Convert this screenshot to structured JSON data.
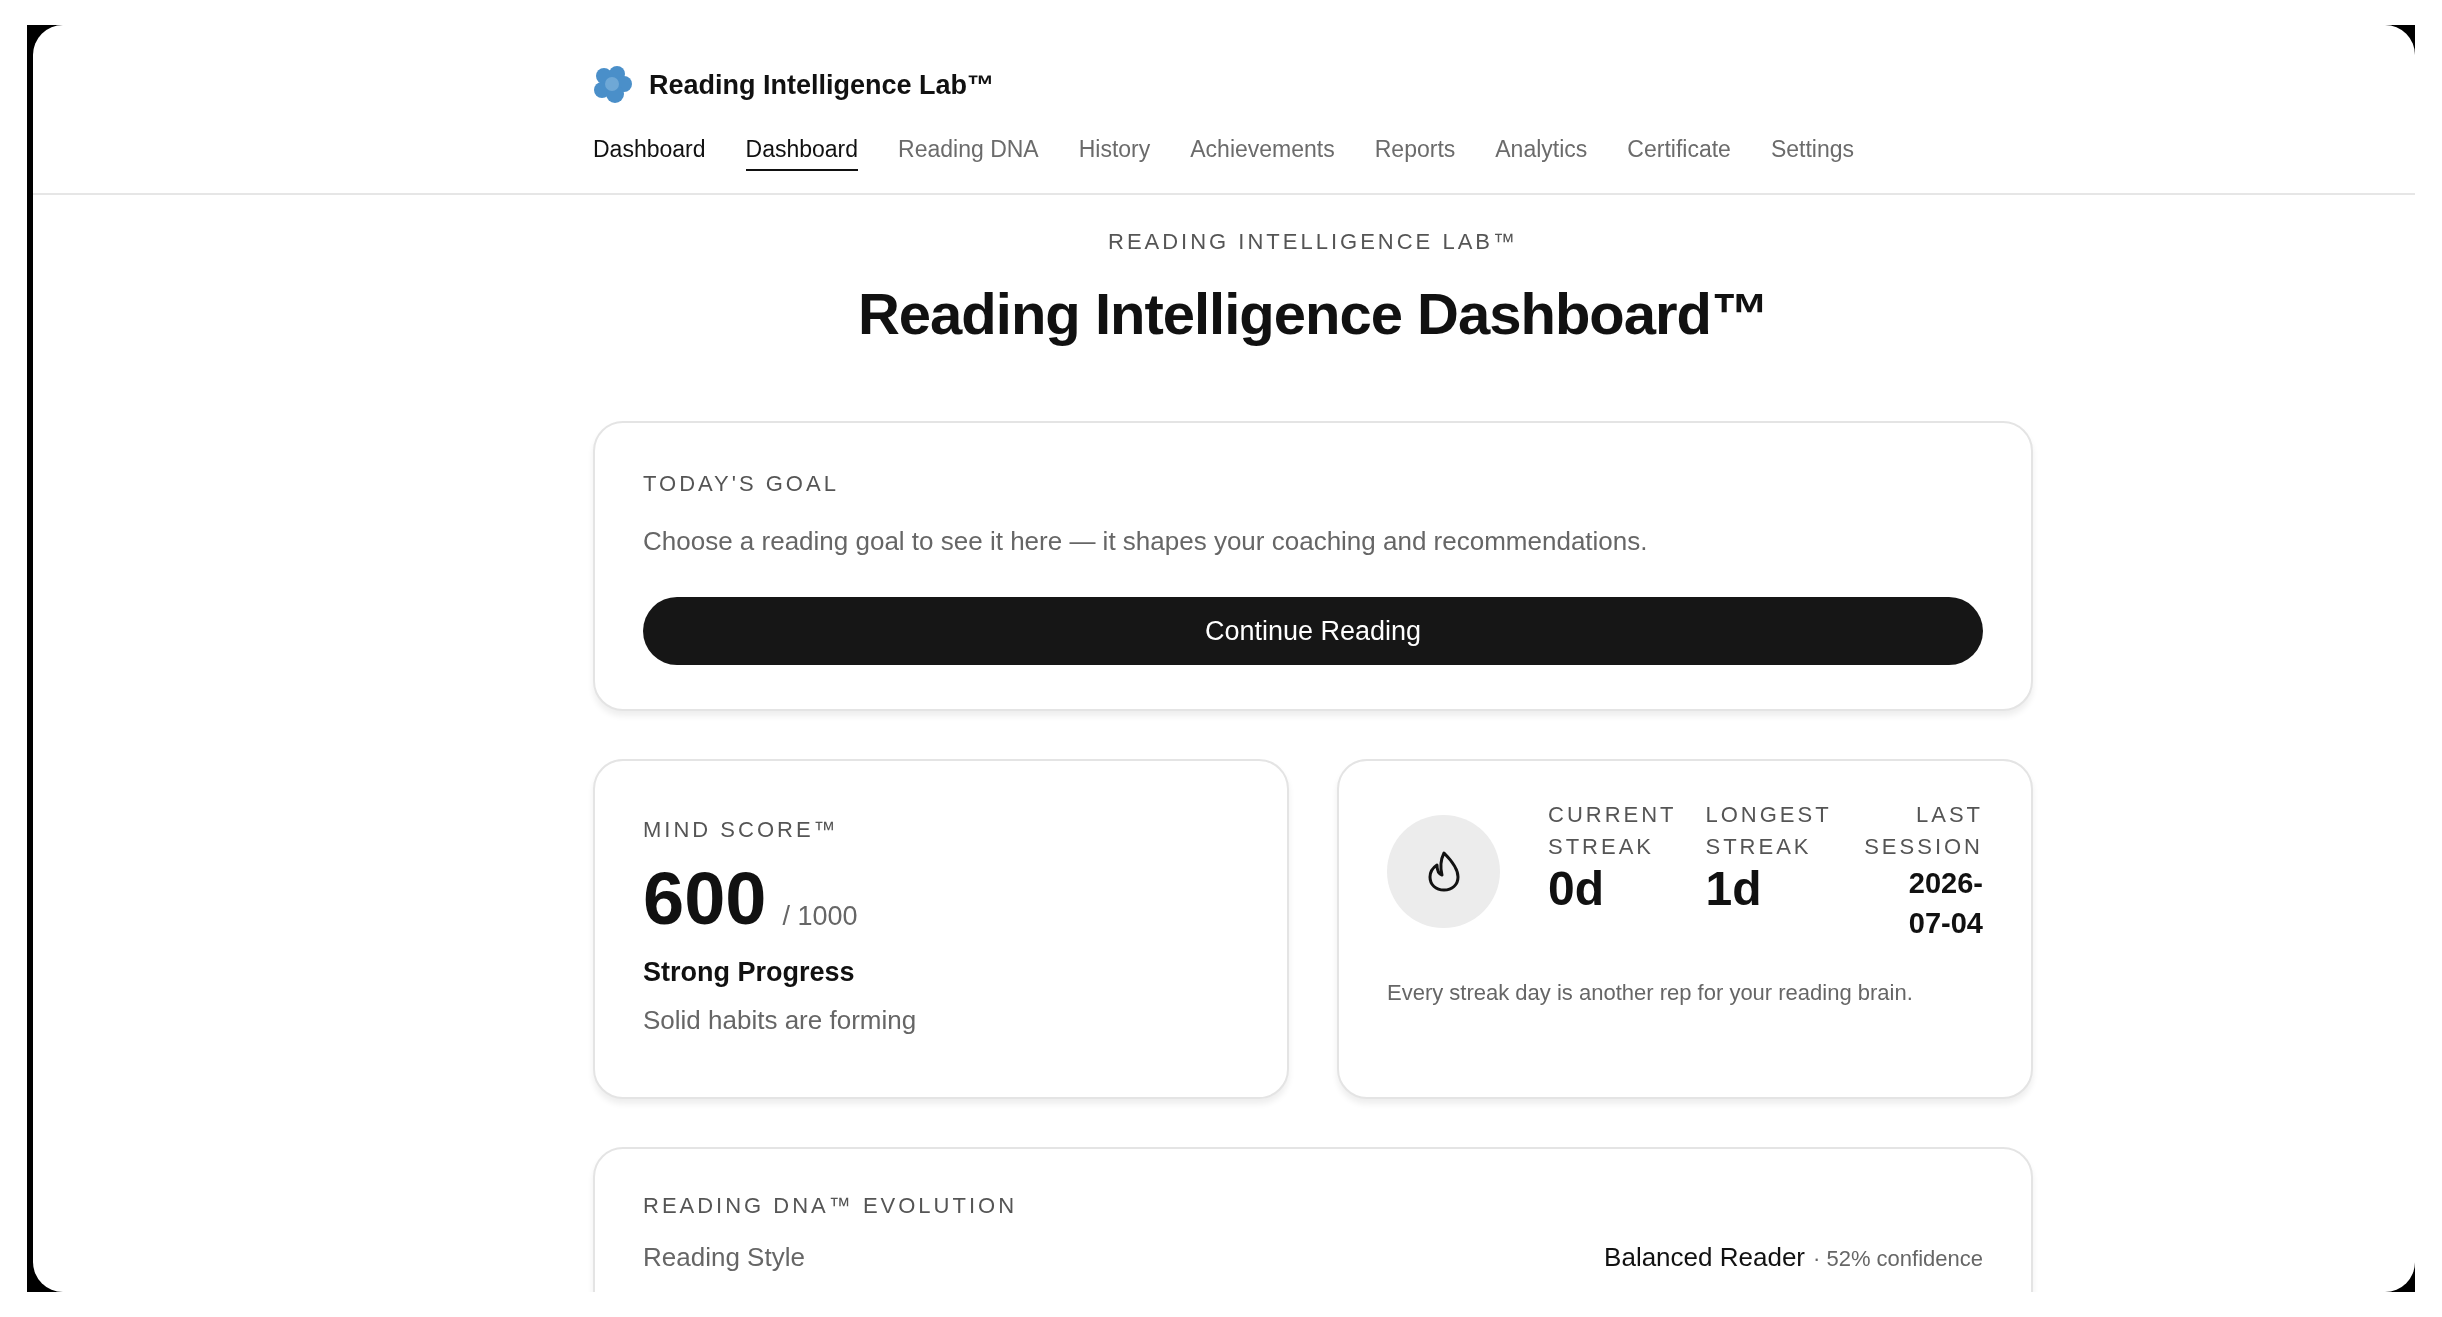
{
  "brand": {
    "name": "Reading Intelligence Lab™"
  },
  "nav": [
    {
      "label": "Dashboard",
      "kind": "home",
      "selected": false
    },
    {
      "label": "Dashboard",
      "kind": "tab",
      "selected": true
    },
    {
      "label": "Reading DNA",
      "kind": "tab",
      "selected": false
    },
    {
      "label": "History",
      "kind": "tab",
      "selected": false
    },
    {
      "label": "Achievements",
      "kind": "tab",
      "selected": false
    },
    {
      "label": "Reports",
      "kind": "tab",
      "selected": false
    },
    {
      "label": "Analytics",
      "kind": "tab",
      "selected": false
    },
    {
      "label": "Certificate",
      "kind": "tab",
      "selected": false
    },
    {
      "label": "Settings",
      "kind": "tab",
      "selected": false
    }
  ],
  "header": {
    "kicker": "READING INTELLIGENCE LAB™",
    "title": "Reading Intelligence Dashboard™"
  },
  "goal": {
    "label": "TODAY'S GOAL",
    "text": "Choose a reading goal to see it here — it shapes your coaching and recommendations.",
    "button": "Continue Reading"
  },
  "mind_score": {
    "label": "MIND SCORE™",
    "score": "600",
    "max": "/ 1000",
    "status": "Strong Progress",
    "note": "Solid habits are forming"
  },
  "streak": {
    "stats": [
      {
        "label": "CURRENT STREAK",
        "value": "0d",
        "kind": "count"
      },
      {
        "label": "LONGEST STREAK",
        "value": "1d",
        "kind": "count"
      },
      {
        "label": "LAST SESSION",
        "value": "2026-07-04",
        "kind": "date"
      }
    ],
    "note": "Every streak day is another rep for your reading brain."
  },
  "dna": {
    "label": "READING DNA™ EVOLUTION",
    "rows": [
      {
        "label": "Reading Style",
        "value": "Balanced Reader",
        "detail": "· 52% confidence"
      }
    ]
  }
}
